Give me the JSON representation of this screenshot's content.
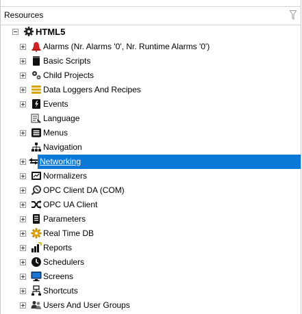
{
  "panel": {
    "title": "Resources"
  },
  "tree": {
    "root": {
      "label": "HTML5",
      "icon": "gear-icon"
    },
    "items": [
      {
        "label": "Alarms (Nr. Alarms '0', Nr. Runtime Alarms '0')",
        "icon": "alarm-bell-icon",
        "expandable": true
      },
      {
        "label": "Basic Scripts",
        "icon": "script-icon",
        "expandable": true
      },
      {
        "label": "Child Projects",
        "icon": "gears-icon",
        "expandable": true
      },
      {
        "label": "Data Loggers And Recipes",
        "icon": "database-icon",
        "expandable": true
      },
      {
        "label": "Events",
        "icon": "events-icon",
        "expandable": true
      },
      {
        "label": "Language",
        "icon": "language-icon",
        "expandable": false
      },
      {
        "label": "Menus",
        "icon": "menu-icon",
        "expandable": true
      },
      {
        "label": "Navigation",
        "icon": "navigation-icon",
        "expandable": false
      },
      {
        "label": "Networking",
        "icon": "networking-icon",
        "expandable": true,
        "selected": true
      },
      {
        "label": "Normalizers",
        "icon": "normalizer-icon",
        "expandable": true
      },
      {
        "label": "OPC Client DA (COM)",
        "icon": "opc-da-icon",
        "expandable": true
      },
      {
        "label": "OPC UA Client",
        "icon": "opc-ua-icon",
        "expandable": true
      },
      {
        "label": "Parameters",
        "icon": "parameters-icon",
        "expandable": true
      },
      {
        "label": "Real Time DB",
        "icon": "realtime-db-icon",
        "expandable": true
      },
      {
        "label": "Reports",
        "icon": "reports-icon",
        "expandable": true
      },
      {
        "label": "Schedulers",
        "icon": "clock-icon",
        "expandable": true
      },
      {
        "label": "Screens",
        "icon": "monitor-icon",
        "expandable": true
      },
      {
        "label": "Shortcuts",
        "icon": "shortcut-icon",
        "expandable": true
      },
      {
        "label": "Users And User Groups",
        "icon": "users-icon",
        "expandable": true
      }
    ]
  },
  "colors": {
    "selection": "#0a78d7",
    "alarm": "#d32020",
    "database": "#d7a400",
    "realtime": "#e0a000"
  }
}
